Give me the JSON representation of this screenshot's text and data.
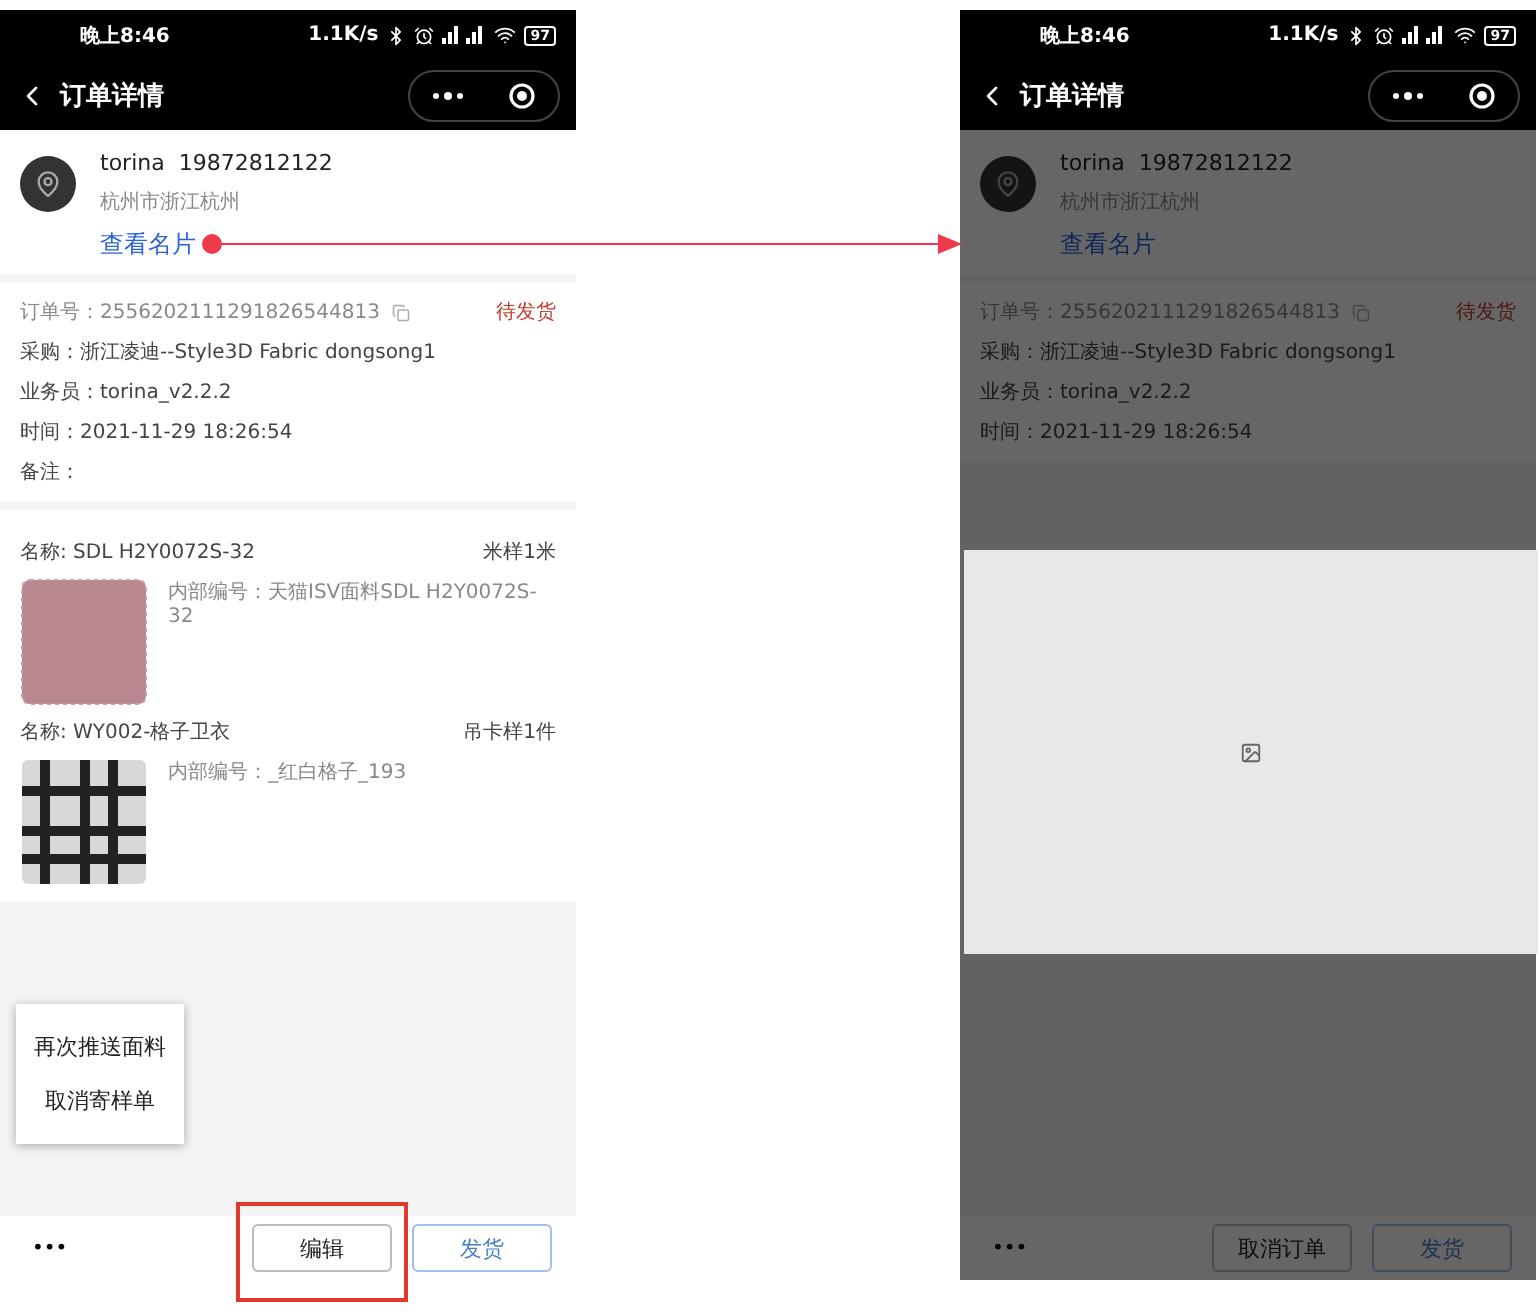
{
  "phones": [
    {
      "dimmed": false,
      "status_bar": {
        "time": "晚上8:46",
        "speed": "1.1K/s",
        "battery": "97"
      },
      "nav": {
        "title": "订单详情"
      },
      "contact": {
        "name": "torina",
        "phone": "19872812122",
        "address": "杭州市浙江杭州",
        "link": "查看名片"
      },
      "order": {
        "number_label": "订单号：",
        "number": "2556202111291826544813",
        "status": "待发货",
        "rows": [
          "采购：浙江凌迪--Style3D Fabric dongsong1",
          "业务员：torina_v2.2.2",
          "时间：2021-11-29 18:26:54",
          "备注："
        ]
      },
      "products": [
        {
          "name": "名称: SDL H2Y0072S-32",
          "spec": "米样1米",
          "code": "内部编号：天猫ISV面料SDL H2Y0072S-32",
          "kind": "solid"
        },
        {
          "name": "名称: WY002-格子卫衣",
          "spec": "吊卡样1件",
          "code": "内部编号：_红白格子_193",
          "kind": "plaid"
        }
      ],
      "menu": [
        "再次推送面料",
        "取消寄样单"
      ],
      "bottom": {
        "more": "•••",
        "buttons": [
          {
            "label": "编辑",
            "kind": "default",
            "highlighted": true
          },
          {
            "label": "发货",
            "kind": "primary",
            "highlighted": false
          }
        ]
      }
    },
    {
      "dimmed": true,
      "status_bar": {
        "time": "晚上8:46",
        "speed": "1.1K/s",
        "battery": "97"
      },
      "nav": {
        "title": "订单详情"
      },
      "contact": {
        "name": "torina",
        "phone": "19872812122",
        "address": "杭州市浙江杭州",
        "link": "查看名片"
      },
      "order": {
        "number_label": "订单号：",
        "number": "2556202111291826544813",
        "status": "待发货",
        "rows": [
          "采购：浙江凌迪--Style3D Fabric dongsong1",
          "业务员：torina_v2.2.2",
          "时间：2021-11-29 18:26:54"
        ]
      },
      "bottom": {
        "more": "•••",
        "buttons": [
          {
            "label": "取消订单",
            "kind": "default",
            "highlighted": false
          },
          {
            "label": "发货",
            "kind": "primary",
            "highlighted": false
          }
        ]
      }
    }
  ]
}
